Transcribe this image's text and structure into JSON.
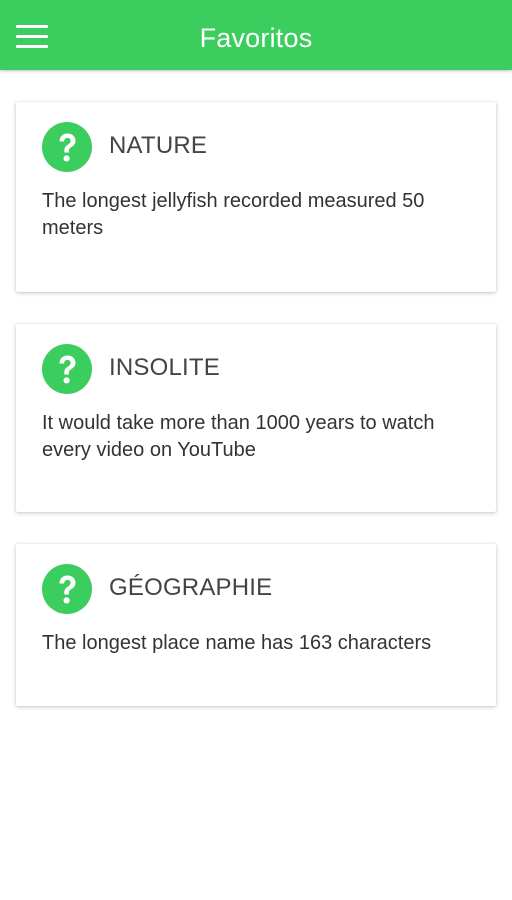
{
  "header": {
    "title": "Favoritos",
    "menu_icon": "hamburger-menu-icon",
    "background_color": "#3ccd5f"
  },
  "cards": [
    {
      "icon": "question-mark-icon",
      "category": "NATURE",
      "fact": "The longest jellyfish recorded measured 50 meters"
    },
    {
      "icon": "question-mark-icon",
      "category": "INSOLITE",
      "fact": "It would take more than 1000 years to watch every video on YouTube"
    },
    {
      "icon": "question-mark-icon",
      "category": "GÉOGRAPHIE",
      "fact": "The longest place name has 163 characters"
    }
  ],
  "colors": {
    "accent": "#3ccd5f",
    "category_text": "#444444",
    "fact_text": "#333333"
  }
}
